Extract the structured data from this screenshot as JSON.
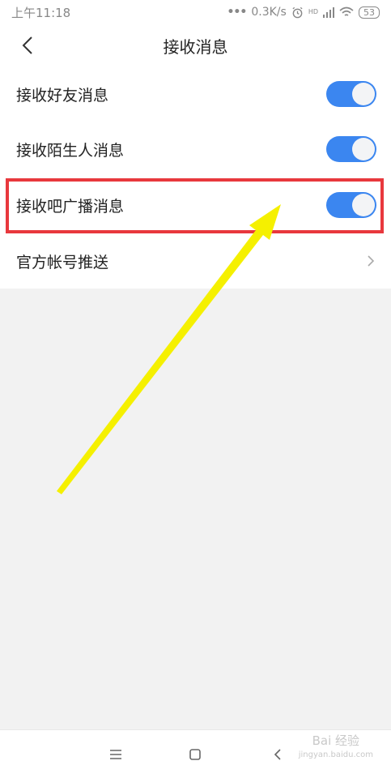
{
  "status_bar": {
    "time": "上午11:18",
    "network_speed": "0.3K/s",
    "signal_label": "HD",
    "battery": "53",
    "icons": [
      "dots-icon",
      "alarm-icon",
      "signal-icon",
      "wifi-icon",
      "battery-icon"
    ]
  },
  "header": {
    "title": "接收消息",
    "back_icon": "chevron-left-icon"
  },
  "settings": {
    "items": [
      {
        "label": "接收好友消息",
        "control": "toggle",
        "enabled": true
      },
      {
        "label": "接收陌生人消息",
        "control": "toggle",
        "enabled": true
      },
      {
        "label": "接收吧广播消息",
        "control": "toggle",
        "enabled": true,
        "highlighted": true
      },
      {
        "label": "官方帐号推送",
        "control": "chevron"
      }
    ]
  },
  "annotation": {
    "highlight_color": "#e8383d",
    "arrow_color": "#f5f000"
  },
  "nav_bar": {
    "icons": [
      "menu-icon",
      "home-square-icon",
      "back-icon"
    ]
  },
  "watermark": {
    "text": "Bai  经验",
    "subtext": "jingyan.baidu.com"
  },
  "colors": {
    "toggle_on": "#3b86f0",
    "text_primary": "#222222",
    "background": "#f2f2f2"
  }
}
